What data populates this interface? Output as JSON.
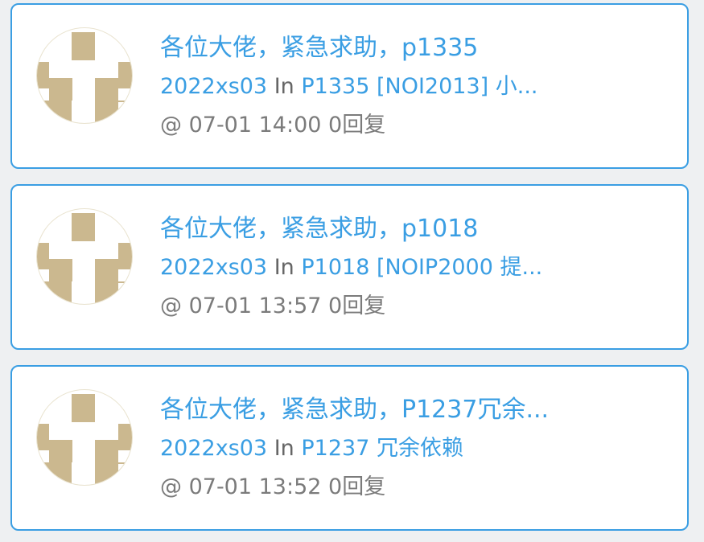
{
  "colors": {
    "accent": "#3a9ee3",
    "meta_text": "#7b7b7b",
    "avatar_fill": "#cbb88f"
  },
  "posts": [
    {
      "title": "各位大佬，紧急求助，p1335",
      "user": "2022xs03",
      "in_word": "In",
      "problem": "P1335 [NOI2013] 小...",
      "meta": "@ 07-01 14:00 0回复",
      "avatar_icon": "identicon-avatar"
    },
    {
      "title": "各位大佬，紧急求助，p1018",
      "user": "2022xs03",
      "in_word": "In",
      "problem": "P1018 [NOIP2000 提...",
      "meta": "@ 07-01 13:57 0回复",
      "avatar_icon": "identicon-avatar"
    },
    {
      "title": "各位大佬，紧急求助，P1237冗余...",
      "user": "2022xs03",
      "in_word": "In",
      "problem": "P1237 冗余依赖",
      "meta": "@ 07-01 13:52 0回复",
      "avatar_icon": "identicon-avatar"
    }
  ]
}
